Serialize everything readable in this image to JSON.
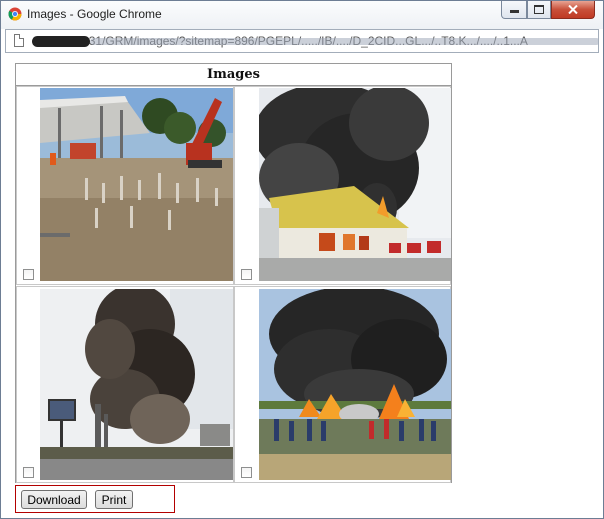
{
  "window": {
    "title": "Images - Google Chrome",
    "controls": {
      "minimize": "–",
      "maximize": "□",
      "close": "✕"
    }
  },
  "address_bar": {
    "url": "192.168.2.31/GRM/images/?sitemap=896/PGEPL/...../IB/..../D_2CID...GL.../..T8.K.../..../..1...A"
  },
  "page": {
    "table_header": "Images",
    "images": [
      {
        "icon": "construction-site-photo",
        "checked": false
      },
      {
        "icon": "warehouse-fire-photo",
        "checked": false
      },
      {
        "icon": "industrial-smoke-photo",
        "checked": false
      },
      {
        "icon": "firefighters-fire-photo",
        "checked": false
      }
    ],
    "buttons": {
      "download": "Download",
      "print": "Print"
    }
  },
  "colors": {
    "title_bar": "#eef1f5",
    "close_button": "#c8503a",
    "actions_border": "#b30000",
    "smoke": "#2b2b2b"
  }
}
